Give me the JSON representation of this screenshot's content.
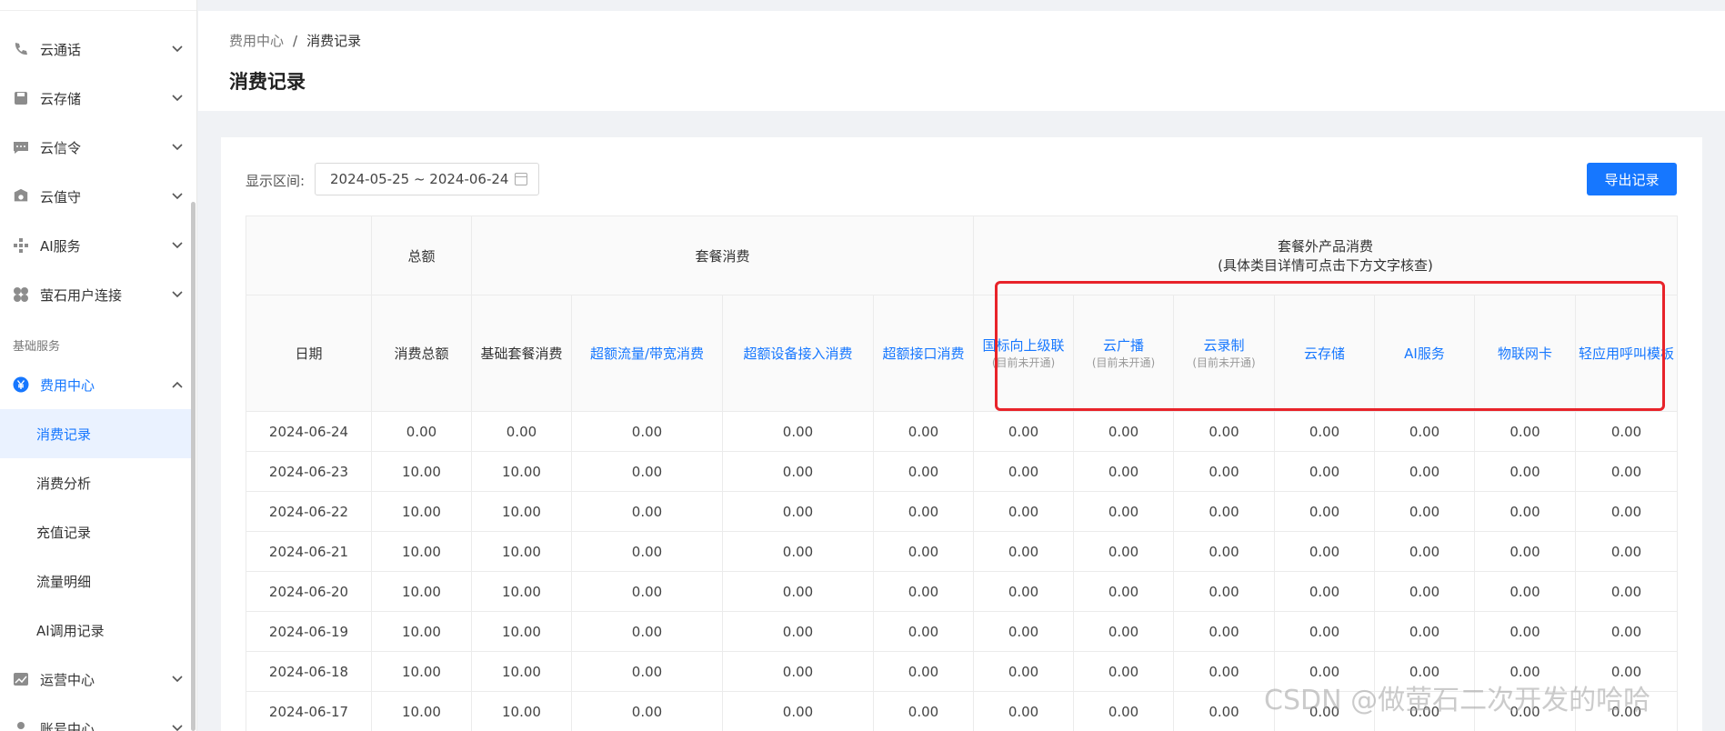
{
  "sidebar": {
    "items": [
      {
        "label": "云通话",
        "icon": "phone-icon"
      },
      {
        "label": "云存储",
        "icon": "storage-icon"
      },
      {
        "label": "云信令",
        "icon": "chat-icon"
      },
      {
        "label": "云值守",
        "icon": "shield-icon"
      },
      {
        "label": "AI服务",
        "icon": "ai-icon"
      },
      {
        "label": "萤石用户连接",
        "icon": "connect-icon"
      }
    ],
    "group_label": "基础服务",
    "billing": {
      "label": "费用中心",
      "icon": "yen-icon"
    },
    "billing_subitems": [
      "消费记录",
      "消费分析",
      "充值记录",
      "流量明细",
      "AI调用记录"
    ],
    "ops": {
      "label": "运营中心",
      "icon": "chart-icon"
    },
    "account": {
      "label": "账号中心"
    }
  },
  "header": {
    "breadcrumb_root": "费用中心",
    "breadcrumb_sep": "/",
    "breadcrumb_current": "消费记录",
    "title": "消费记录"
  },
  "filter": {
    "label": "显示区间:",
    "range": "2024-05-25 ~ 2024-06-24"
  },
  "export_label": "导出记录",
  "table": {
    "group_total": "总额",
    "group_package": "套餐消费",
    "group_extra_line1": "套餐外产品消费",
    "group_extra_line2": "(具体类目详情可点击下方文字核查)",
    "columns": {
      "date": "日期",
      "total": "消费总额",
      "base": "基础套餐消费",
      "overflow": "超额流量/带宽消费",
      "device": "超额设备接入消费",
      "api": "超额接口消费",
      "cascade": "国标向上级联",
      "cascade_note": "(目前未开通)",
      "broadcast": "云广播",
      "broadcast_note": "(目前未开通)",
      "record": "云录制",
      "record_note": "(目前未开通)",
      "storage": "云存储",
      "ai": "AI服务",
      "iot": "物联网卡",
      "call": "轻应用呼叫模板"
    },
    "rows": [
      [
        "2024-06-24",
        "0.00",
        "0.00",
        "0.00",
        "0.00",
        "0.00",
        "0.00",
        "0.00",
        "0.00",
        "0.00",
        "0.00",
        "0.00",
        "0.00"
      ],
      [
        "2024-06-23",
        "10.00",
        "10.00",
        "0.00",
        "0.00",
        "0.00",
        "0.00",
        "0.00",
        "0.00",
        "0.00",
        "0.00",
        "0.00",
        "0.00"
      ],
      [
        "2024-06-22",
        "10.00",
        "10.00",
        "0.00",
        "0.00",
        "0.00",
        "0.00",
        "0.00",
        "0.00",
        "0.00",
        "0.00",
        "0.00",
        "0.00"
      ],
      [
        "2024-06-21",
        "10.00",
        "10.00",
        "0.00",
        "0.00",
        "0.00",
        "0.00",
        "0.00",
        "0.00",
        "0.00",
        "0.00",
        "0.00",
        "0.00"
      ],
      [
        "2024-06-20",
        "10.00",
        "10.00",
        "0.00",
        "0.00",
        "0.00",
        "0.00",
        "0.00",
        "0.00",
        "0.00",
        "0.00",
        "0.00",
        "0.00"
      ],
      [
        "2024-06-19",
        "10.00",
        "10.00",
        "0.00",
        "0.00",
        "0.00",
        "0.00",
        "0.00",
        "0.00",
        "0.00",
        "0.00",
        "0.00",
        "0.00"
      ],
      [
        "2024-06-18",
        "10.00",
        "10.00",
        "0.00",
        "0.00",
        "0.00",
        "0.00",
        "0.00",
        "0.00",
        "0.00",
        "0.00",
        "0.00",
        "0.00"
      ],
      [
        "2024-06-17",
        "10.00",
        "10.00",
        "0.00",
        "0.00",
        "0.00",
        "0.00",
        "0.00",
        "0.00",
        "0.00",
        "0.00",
        "0.00",
        "0.00"
      ]
    ]
  },
  "watermark": "CSDN @做萤石二次开发的哈哈"
}
